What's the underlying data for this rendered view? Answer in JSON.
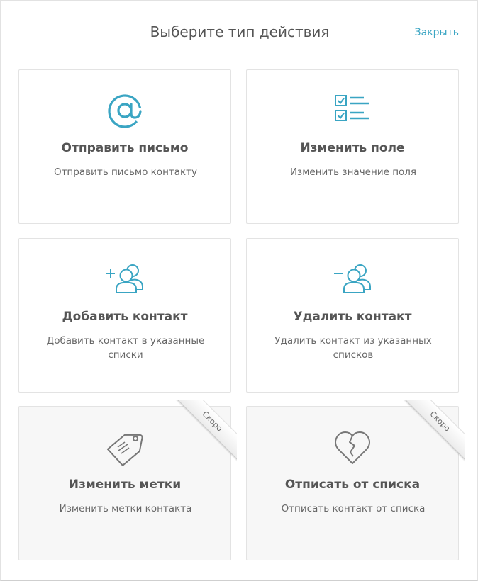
{
  "header": {
    "title": "Выберите тип действия",
    "close_label": "Закрыть"
  },
  "colors": {
    "accent": "#3aa5c3",
    "disabled_icon": "#777777",
    "title_text": "#555555"
  },
  "cards": [
    {
      "icon": "at-sign-icon",
      "title": "Отправить письмо",
      "description": "Отправить письмо контакту",
      "soon": false
    },
    {
      "icon": "checklist-icon",
      "title": "Изменить поле",
      "description": "Изменить значение поля",
      "soon": false
    },
    {
      "icon": "add-contact-icon",
      "title": "Добавить контакт",
      "description": "Добавить контакт в указанные списки",
      "soon": false
    },
    {
      "icon": "remove-contact-icon",
      "title": "Удалить контакт",
      "description": "Удалить контакт из указанных списков",
      "soon": false
    },
    {
      "icon": "tag-icon",
      "title": "Изменить метки",
      "description": "Изменить метки контакта",
      "soon": true,
      "badge": "Скоро"
    },
    {
      "icon": "broken-heart-icon",
      "title": "Отписать от списка",
      "description": "Отписать контакт от списка",
      "soon": true,
      "badge": "Скоро"
    }
  ]
}
